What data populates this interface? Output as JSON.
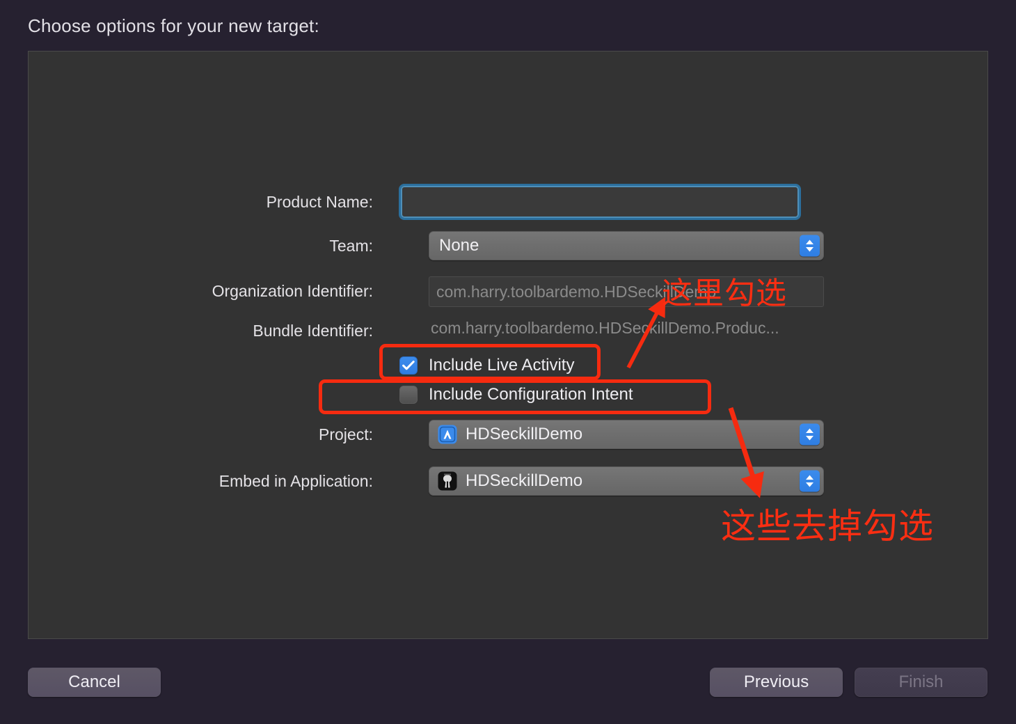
{
  "dialog": {
    "title": "Choose options for your new target:"
  },
  "form": {
    "product_name": {
      "label": "Product Name:",
      "value": "",
      "placeholder": ""
    },
    "team": {
      "label": "Team:",
      "value": "None",
      "stepper_icon": "chevron-up-down-icon"
    },
    "organization_identifier": {
      "label": "Organization Identifier:",
      "value": "com.harry.toolbardemo.HDSeckillDemo"
    },
    "bundle_identifier": {
      "label": "Bundle Identifier:",
      "value": "com.harry.toolbardemo.HDSeckillDemo.Produc..."
    },
    "include_live_activity": {
      "label": "Include Live Activity",
      "checked": true
    },
    "include_configuration_intent": {
      "label": "Include Configuration Intent",
      "checked": false
    },
    "project": {
      "label": "Project:",
      "value": "HDSeckillDemo",
      "icon": "xcode-project-icon",
      "stepper_icon": "chevron-up-down-icon"
    },
    "embed_in_application": {
      "label": "Embed in Application:",
      "value": "HDSeckillDemo",
      "icon": "app-bundle-icon",
      "stepper_icon": "chevron-up-down-icon"
    }
  },
  "buttons": {
    "cancel": "Cancel",
    "previous": "Previous",
    "finish": "Finish"
  },
  "annotations": {
    "top_note": "这里勾选",
    "bottom_note": "这些去掉勾选",
    "color": "#fb2e12"
  },
  "colors": {
    "window_background": "#262130",
    "panel_background": "#333333",
    "accent_blue": "#2f7ce2",
    "focus_ring": "#2a7ab0",
    "annotation_red": "#f62b10",
    "text_primary": "#e4e2e6",
    "text_muted": "#8b8b8b"
  }
}
